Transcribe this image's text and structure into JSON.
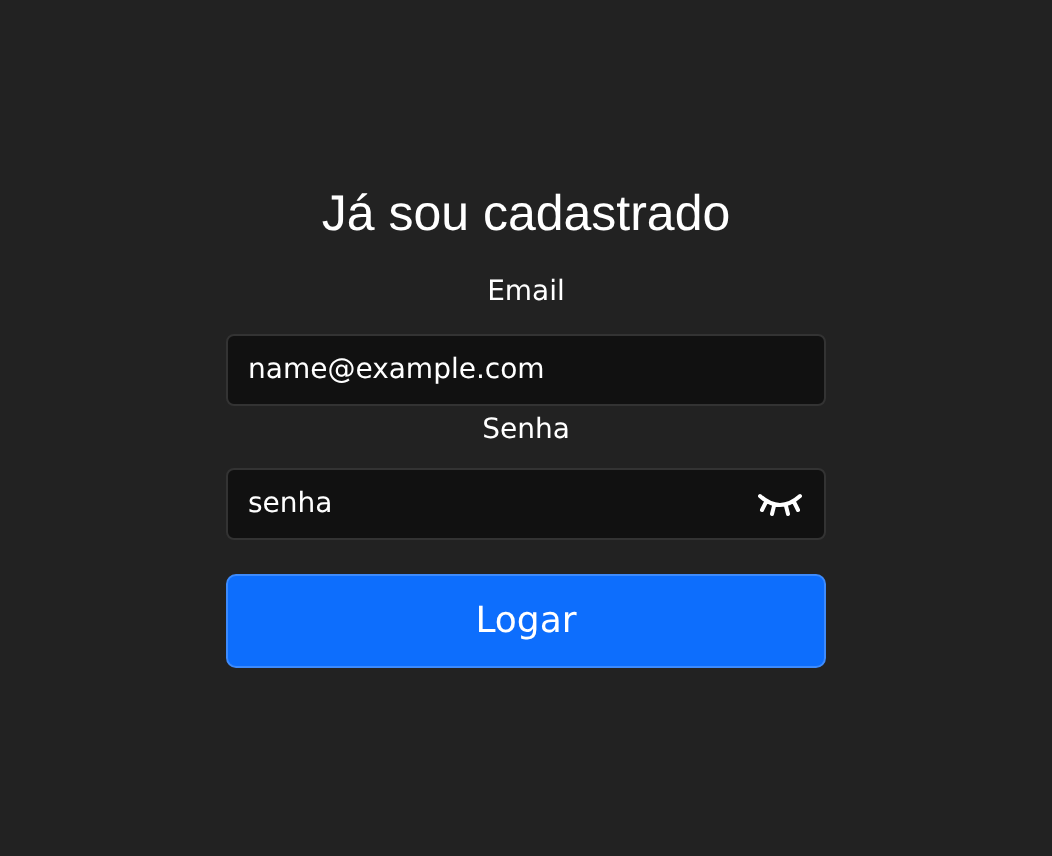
{
  "title": "Já sou cadastrado",
  "fields": [
    {
      "label": "Email",
      "value": "name@example.com",
      "kind": "text"
    },
    {
      "label": "Senha",
      "value": "senha",
      "kind": "password"
    }
  ],
  "button": "Logar"
}
